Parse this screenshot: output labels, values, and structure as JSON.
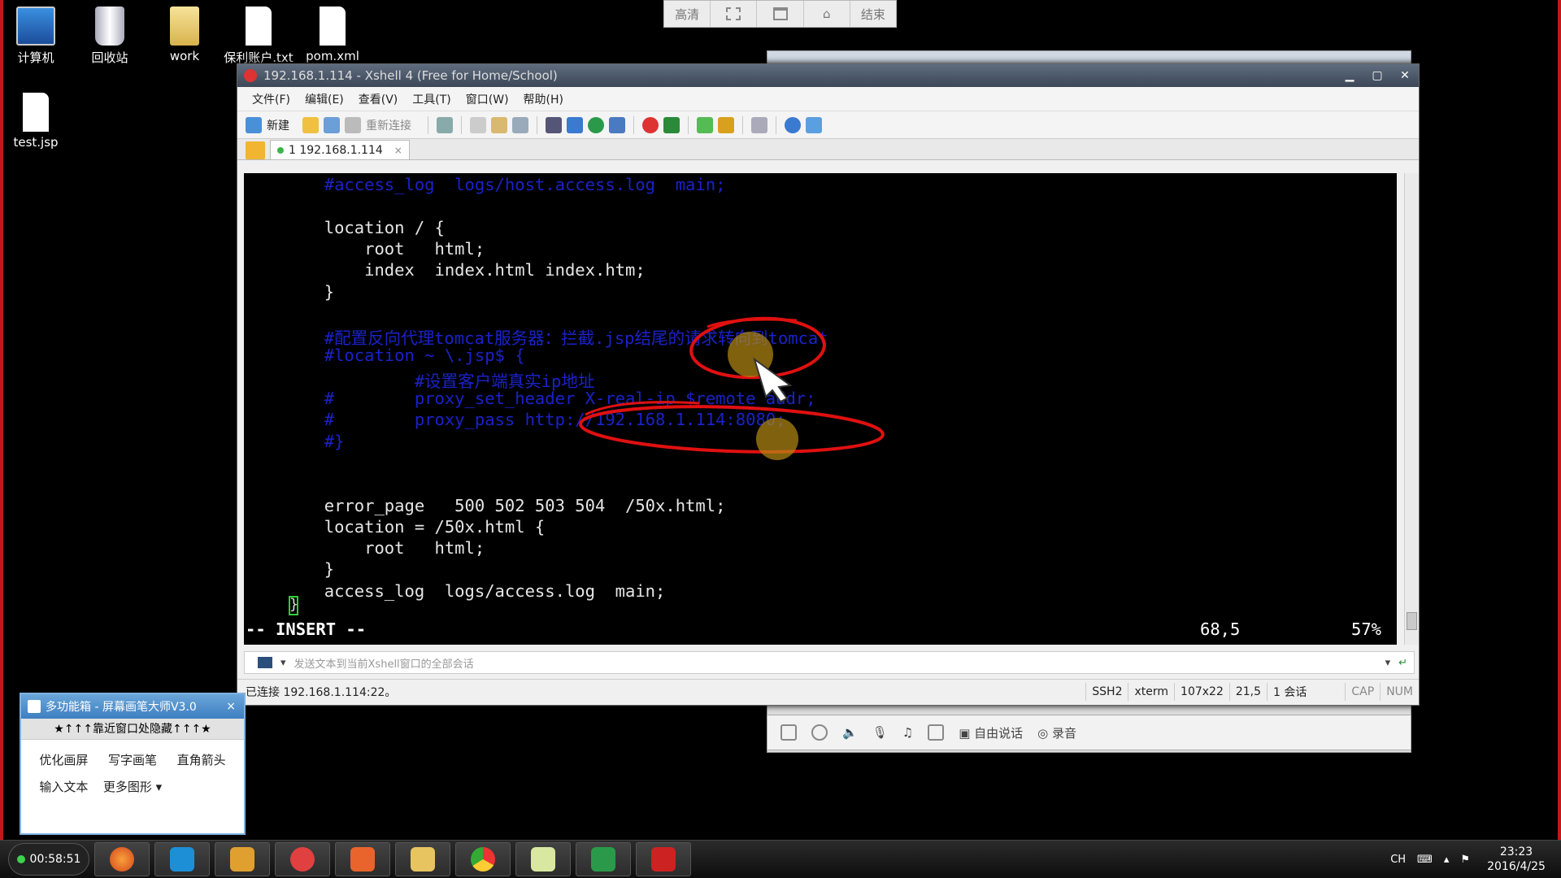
{
  "desktop": {
    "icons": [
      {
        "label": "计算机"
      },
      {
        "label": "回收站"
      },
      {
        "label": "work"
      },
      {
        "label": "保利账户.txt"
      },
      {
        "label": "pom.xml"
      },
      {
        "label": "test.jsp"
      }
    ]
  },
  "recorder_bar": {
    "buttons": [
      "高清",
      "",
      "",
      "",
      "结束"
    ]
  },
  "xshell": {
    "title": "192.168.1.114 - Xshell 4 (Free for Home/School)",
    "menu": [
      "文件(F)",
      "编辑(E)",
      "查看(V)",
      "工具(T)",
      "窗口(W)",
      "帮助(H)"
    ],
    "toolbar": {
      "new_label": "新建",
      "reconnect_label": "重新连接"
    },
    "tab": {
      "label": "1 192.168.1.114",
      "close": "×"
    },
    "terminal": {
      "lines": [
        {
          "text": "        #access_log  logs/host.access.log  main;",
          "type": "comment"
        },
        {
          "text": "",
          "type": "code"
        },
        {
          "text": "        location / {",
          "type": "code"
        },
        {
          "text": "            root   html;",
          "type": "code"
        },
        {
          "text": "            index  index.html index.htm;",
          "type": "code"
        },
        {
          "text": "        }",
          "type": "code"
        },
        {
          "text": "",
          "type": "code"
        },
        {
          "text": "        #配置反向代理tomcat服务器：拦截.jsp结尾的请求转向到tomcat",
          "type": "comment"
        },
        {
          "text": "        #location ~ \\.jsp$ {",
          "type": "comment"
        },
        {
          "text": "                 #设置客户端真实ip地址",
          "type": "comment"
        },
        {
          "text": "        #        proxy_set_header X-real-ip $remote_addr;",
          "type": "comment"
        },
        {
          "text": "        #        proxy_pass http://192.168.1.114:8080;",
          "type": "comment"
        },
        {
          "text": "        #}",
          "type": "comment"
        },
        {
          "text": "",
          "type": "code"
        },
        {
          "text": "",
          "type": "code"
        },
        {
          "text": "        error_page   500 502 503 504  /50x.html;",
          "type": "code"
        },
        {
          "text": "        location = /50x.html {",
          "type": "code"
        },
        {
          "text": "            root   html;",
          "type": "code"
        },
        {
          "text": "        }",
          "type": "code"
        },
        {
          "text": "        access_log  logs/access.log  main;",
          "type": "code"
        }
      ],
      "cursor_char": "}",
      "mode": "-- INSERT --",
      "position": "68,5",
      "percent": "57%"
    },
    "sendbar_placeholder": "发送文本到当前Xshell窗口的全部会话",
    "status": {
      "connected": "已连接 192.168.1.114:22。",
      "protocol": "SSH2",
      "term": "xterm",
      "size": "107x22",
      "cursor": "21,5",
      "sessions": "1 会话",
      "cap": "CAP",
      "num": "NUM"
    }
  },
  "bg_window_bottom": {
    "free_talk": "自由说话",
    "record": "录音"
  },
  "pen_panel": {
    "title": "多功能箱 - 屏幕画笔大师V3.0",
    "close": "×",
    "hide_hint": "★↑↑↑靠近窗口处隐藏↑↑↑★",
    "tools": [
      "优化画屏",
      "写字画笔",
      "直角箭头",
      "输入文本",
      "更多图形 ▾"
    ]
  },
  "taskbar": {
    "timer": "00:58:51",
    "tray": {
      "lang": "CH"
    },
    "clock": {
      "time": "23:23",
      "date": "2016/4/25"
    }
  },
  "colors": {
    "terminal_bg": "#000000",
    "code_text": "#e6e6e6",
    "comment_text": "#1a22c8",
    "annotation_red": "#e01010"
  }
}
